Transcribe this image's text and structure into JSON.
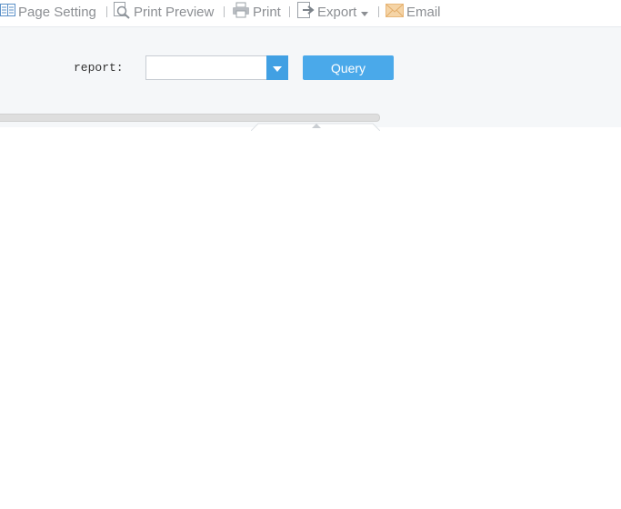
{
  "toolbar": {
    "page_setting": "Page Setting",
    "print_preview": "Print Preview",
    "print": "Print",
    "export": "Export",
    "email": "Email"
  },
  "form": {
    "report_label": "report:",
    "report_value": "",
    "query_label": "Query"
  },
  "colors": {
    "accent": "#4aa9ea",
    "toolbar_text": "#8c8f93",
    "panel_bg": "#f5f7f9"
  },
  "icons": [
    "page-setting-icon",
    "print-preview-icon",
    "print-icon",
    "export-icon",
    "email-icon",
    "dropdown-arrow-icon",
    "collapse-arrow-icon"
  ]
}
